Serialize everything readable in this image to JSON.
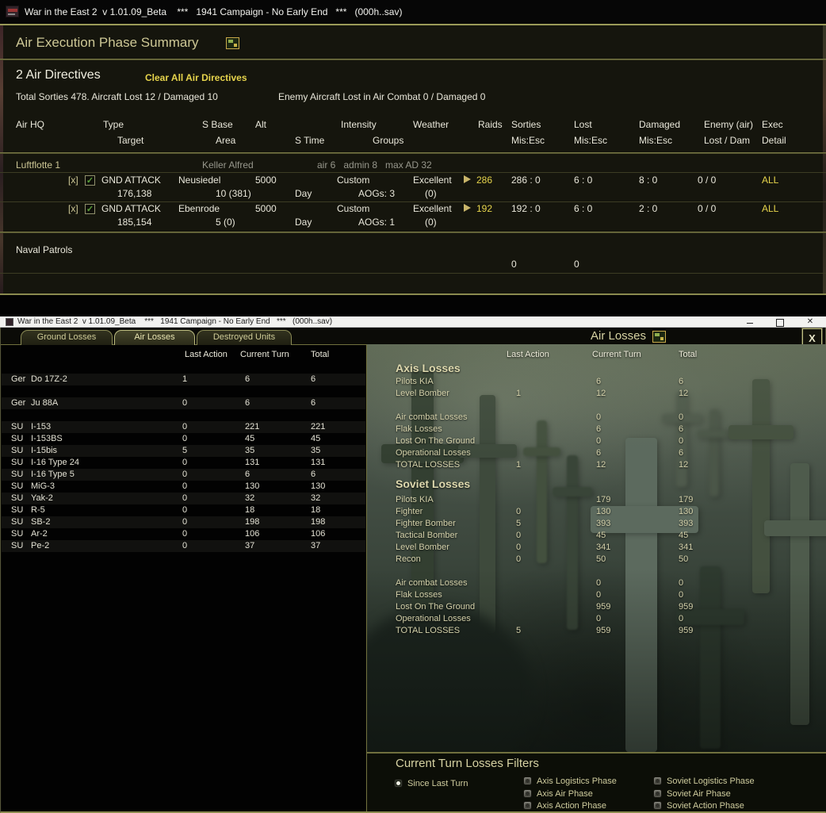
{
  "icons": {
    "check": "✓",
    "close_box": "X",
    "window_close": "✕"
  },
  "top_window": {
    "titlebar": {
      "title": "War in the East 2  v 1.01.09_Beta    ***   1941 Campaign - No Early End   ***   (000h..sav)"
    },
    "panel": {
      "title": "Air Execution Phase Summary",
      "directives_count": "2 Air Directives",
      "clear_all_label": "Clear All Air Directives",
      "totals_friendly": "Total Sorties 478. Aircraft Lost 12 / Damaged 10",
      "totals_enemy": "Enemy Aircraft Lost in Air Combat 0 / Damaged 0",
      "headers": {
        "air_hq": "Air HQ",
        "type": "Type",
        "s_base": "S Base",
        "alt": "Alt",
        "intensity": "Intensity",
        "weather": "Weather",
        "raids": "Raids",
        "sorties": "Sorties",
        "lost": "Lost",
        "damaged": "Damaged",
        "enemy_air": "Enemy (air)",
        "exec": "Exec",
        "target": "Target",
        "area": "Area",
        "s_time": "S Time",
        "groups": "Groups",
        "mis_esc": "Mis:Esc",
        "lost_dam": "Lost / Dam",
        "detail": "Detail"
      },
      "hq_row": {
        "name": "Luftflotte 1",
        "commander": "Keller Alfred",
        "stats": "air 6   admin 8   max AD 32"
      },
      "directives": [
        {
          "sel": "[x]",
          "type": "GND ATTACK",
          "base": "Neusiedel",
          "alt": "5000",
          "intensity": "Custom",
          "weather": "Excellent",
          "raids": "286",
          "sorties": "286 : 0",
          "lost": "6 : 0",
          "damaged": "8 : 0",
          "enemy": "0 / 0",
          "exec": "ALL",
          "target": "176,138",
          "area": "10 (381)",
          "s_time": "Day",
          "groups": "AOGs: 3",
          "weather_detail": "(0)"
        },
        {
          "sel": "[x]",
          "type": "GND ATTACK",
          "base": "Ebenrode",
          "alt": "5000",
          "intensity": "Custom",
          "weather": "Excellent",
          "raids": "192",
          "sorties": "192 : 0",
          "lost": "6 : 0",
          "damaged": "2 : 0",
          "enemy": "0 / 0",
          "exec": "ALL",
          "target": "185,154",
          "area": "5 (0)",
          "s_time": "Day",
          "groups": "AOGs: 1",
          "weather_detail": "(0)"
        }
      ],
      "naval": {
        "label": "Naval Patrols",
        "sorties": "0",
        "lost": "0"
      }
    }
  },
  "bottom_window": {
    "titlebar": {
      "title": "War in the East 2  v 1.01.09_Beta    ***   1941 Campaign - No Early End   ***   (000h..sav)"
    },
    "tabs": [
      {
        "label": "Ground Losses"
      },
      {
        "label": "Air Losses"
      },
      {
        "label": "Destroyed Units"
      }
    ],
    "panel_title": "Air Losses",
    "left_table": {
      "headers": {
        "last": "Last Action",
        "current": "Current Turn",
        "total": "Total"
      },
      "rows": [
        {
          "nation": "Ger",
          "name": "Do 17Z-2",
          "last": "1",
          "current": "6",
          "total": "6"
        },
        {
          "nation": "",
          "name": "",
          "last": "",
          "current": "",
          "total": ""
        },
        {
          "nation": "Ger",
          "name": "Ju 88A",
          "last": "0",
          "current": "6",
          "total": "6"
        },
        {
          "nation": "",
          "name": "",
          "last": "",
          "current": "",
          "total": ""
        },
        {
          "nation": "SU",
          "name": "I-153",
          "last": "0",
          "current": "221",
          "total": "221"
        },
        {
          "nation": "SU",
          "name": "I-153BS",
          "last": "0",
          "current": "45",
          "total": "45"
        },
        {
          "nation": "SU",
          "name": "I-15bis",
          "last": "5",
          "current": "35",
          "total": "35"
        },
        {
          "nation": "SU",
          "name": "I-16 Type 24",
          "last": "0",
          "current": "131",
          "total": "131"
        },
        {
          "nation": "SU",
          "name": "I-16 Type 5",
          "last": "0",
          "current": "6",
          "total": "6"
        },
        {
          "nation": "SU",
          "name": "MiG-3",
          "last": "0",
          "current": "130",
          "total": "130"
        },
        {
          "nation": "SU",
          "name": "Yak-2",
          "last": "0",
          "current": "32",
          "total": "32"
        },
        {
          "nation": "SU",
          "name": "R-5",
          "last": "0",
          "current": "18",
          "total": "18"
        },
        {
          "nation": "SU",
          "name": "SB-2",
          "last": "0",
          "current": "198",
          "total": "198"
        },
        {
          "nation": "SU",
          "name": "Ar-2",
          "last": "0",
          "current": "106",
          "total": "106"
        },
        {
          "nation": "SU",
          "name": "Pe-2",
          "last": "0",
          "current": "37",
          "total": "37"
        }
      ]
    },
    "right_panel": {
      "headers": {
        "last": "Last Action",
        "current": "Current Turn",
        "total": "Total"
      },
      "axis": {
        "heading": "Axis Losses",
        "rows": [
          {
            "label": "Pilots KIA",
            "last": "",
            "current": "6",
            "total": "6"
          },
          {
            "label": "Level Bomber",
            "last": "1",
            "current": "12",
            "total": "12"
          },
          {
            "label": "",
            "last": "",
            "current": "",
            "total": ""
          },
          {
            "label": "Air combat Losses",
            "last": "",
            "current": "0",
            "total": "0"
          },
          {
            "label": "Flak Losses",
            "last": "",
            "current": "6",
            "total": "6"
          },
          {
            "label": "Lost On The Ground",
            "last": "",
            "current": "0",
            "total": "0"
          },
          {
            "label": "Operational Losses",
            "last": "",
            "current": "6",
            "total": "6"
          },
          {
            "label": "TOTAL LOSSES",
            "last": "1",
            "current": "12",
            "total": "12"
          }
        ]
      },
      "soviet": {
        "heading": "Soviet Losses",
        "rows": [
          {
            "label": "Pilots KIA",
            "last": "",
            "current": "179",
            "total": "179"
          },
          {
            "label": "Fighter",
            "last": "0",
            "current": "130",
            "total": "130"
          },
          {
            "label": "Fighter Bomber",
            "last": "5",
            "current": "393",
            "total": "393"
          },
          {
            "label": "Tactical Bomber",
            "last": "0",
            "current": "45",
            "total": "45"
          },
          {
            "label": "Level Bomber",
            "last": "0",
            "current": "341",
            "total": "341"
          },
          {
            "label": "Recon",
            "last": "0",
            "current": "50",
            "total": "50"
          },
          {
            "label": "",
            "last": "",
            "current": "",
            "total": ""
          },
          {
            "label": "Air combat Losses",
            "last": "",
            "current": "0",
            "total": "0"
          },
          {
            "label": "Flak Losses",
            "last": "",
            "current": "0",
            "total": "0"
          },
          {
            "label": "Lost On The Ground",
            "last": "",
            "current": "959",
            "total": "959"
          },
          {
            "label": "Operational Losses",
            "last": "",
            "current": "0",
            "total": "0"
          },
          {
            "label": "TOTAL LOSSES",
            "last": "5",
            "current": "959",
            "total": "959"
          }
        ]
      }
    },
    "filters": {
      "heading": "Current Turn Losses Filters",
      "items": [
        {
          "label": "Since Last Turn",
          "checked": true
        },
        {
          "label": "Axis Logistics Phase",
          "checked": false
        },
        {
          "label": "Axis Air Phase",
          "checked": false
        },
        {
          "label": "Axis Action Phase",
          "checked": false
        },
        {
          "label": "Soviet Logistics Phase",
          "checked": false
        },
        {
          "label": "Soviet Air Phase",
          "checked": false
        },
        {
          "label": "Soviet Action Phase",
          "checked": false
        }
      ]
    }
  }
}
